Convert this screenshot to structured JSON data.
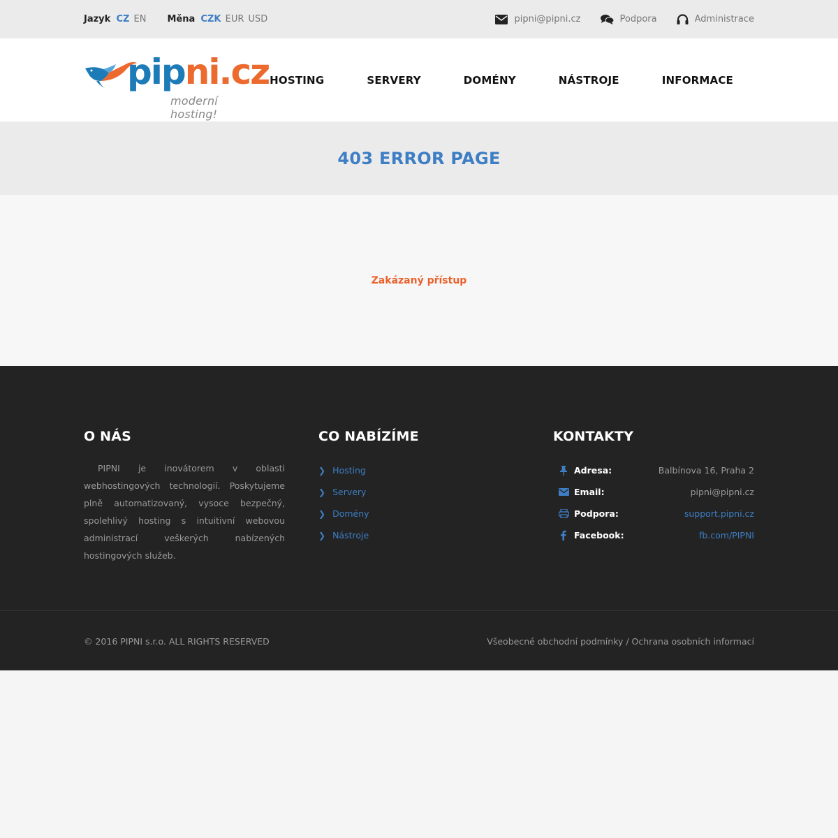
{
  "topbar": {
    "language": {
      "label": "Jazyk",
      "active": "CZ",
      "other": "EN"
    },
    "currency": {
      "label": "Měna",
      "active": "CZK",
      "other1": "EUR",
      "other2": "USD"
    },
    "email": "pipni@pipni.cz",
    "support": "Podpora",
    "admin": "Administrace"
  },
  "logo": {
    "name_part1": "pip",
    "name_part2": "ni.cz",
    "tagline": "moderní hosting!"
  },
  "nav": [
    "HOSTING",
    "SERVERY",
    "DOMÉNY",
    "NÁSTROJE",
    "INFORMACE"
  ],
  "page": {
    "title": "403 ERROR PAGE",
    "message": "Zakázaný přístup"
  },
  "footer": {
    "about": {
      "heading": "O NÁS",
      "text": "PIPNI je inovátorem v oblasti webhostingových technologií. Poskytujeme plně automatizovaný, vysoce bezpečný, spolehlivý hosting s intuitivní webovou administrací veškerých nabízených hostingových služeb."
    },
    "offer": {
      "heading": "CO NABÍZÍME",
      "links": [
        "Hosting",
        "Servery",
        "Domény",
        "Nástroje"
      ]
    },
    "contacts": {
      "heading": "KONTAKTY",
      "address_label": "Adresa:",
      "address": "Balbínova 16, Praha 2",
      "email_label": "Email:",
      "email": "pipni@pipni.cz",
      "support_label": "Podpora:",
      "support": "support.pipni.cz",
      "facebook_label": "Facebook:",
      "facebook": "fb.com/PIPNI"
    },
    "copyright": "© 2016 PIPNI s.r.o. ALL RIGHTS RESERVED",
    "legal_links": "Všeobecné obchodní podmínky / Ochrana osobních informací"
  },
  "colors": {
    "accent": "#3d7ec4",
    "orange": "#e9612c",
    "footer_bg": "#232323"
  }
}
